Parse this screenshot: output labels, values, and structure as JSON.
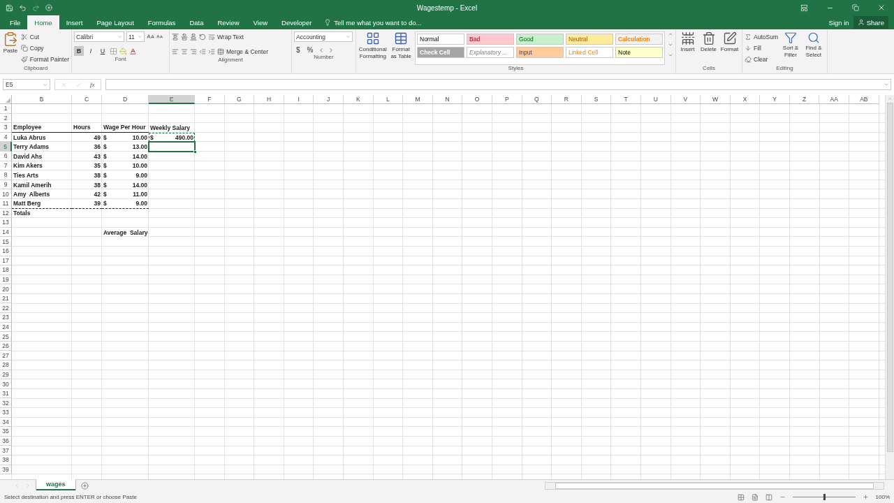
{
  "window": {
    "title": "Wagestemp - Excel",
    "sign_in": "Sign in",
    "share": "Share"
  },
  "menu_tabs": [
    {
      "label": "File",
      "selected": false
    },
    {
      "label": "Home",
      "selected": true
    },
    {
      "label": "Insert",
      "selected": false
    },
    {
      "label": "Page Layout",
      "selected": false
    },
    {
      "label": "Formulas",
      "selected": false
    },
    {
      "label": "Data",
      "selected": false
    },
    {
      "label": "Review",
      "selected": false
    },
    {
      "label": "View",
      "selected": false
    },
    {
      "label": "Developer",
      "selected": false
    }
  ],
  "tell_me": {
    "placeholder": "Tell me what you want to do..."
  },
  "ribbon": {
    "clipboard": {
      "label": "Clipboard",
      "paste": "Paste",
      "commands": [
        "Cut",
        "Copy",
        "Format Painter"
      ]
    },
    "font": {
      "label": "Font",
      "font_name": "Calibri",
      "font_size": "11",
      "toggles": [
        {
          "label": "B",
          "selected": true
        },
        {
          "label": "I",
          "selected": false
        },
        {
          "label": "U",
          "selected": false
        }
      ]
    },
    "alignment": {
      "label": "Alignment",
      "wrap": "Wrap Text",
      "merge": "Merge & Center"
    },
    "number": {
      "label": "Number",
      "format": "Accounting",
      "symbols": [
        "$",
        "%"
      ]
    },
    "styles": {
      "label": "Styles",
      "commands": [
        "Conditional Formatting",
        "Format as Table"
      ],
      "gallery": [
        {
          "label": "Normal",
          "kind": "normal",
          "color": "#ffffff"
        },
        {
          "label": "Bad",
          "kind": "bad",
          "color": "#ffc7ce"
        },
        {
          "label": "Good",
          "kind": "good",
          "color": "#c6efce"
        },
        {
          "label": "Neutral",
          "kind": "neutral",
          "color": "#ffeb9c"
        },
        {
          "label": "Calculation",
          "kind": "calculation",
          "color": "#f2f2f2"
        },
        {
          "label": "Check Cell",
          "kind": "check",
          "color": "#a5a5a5"
        },
        {
          "label": "Explanatory ...",
          "kind": "explanatory",
          "color": "#ffffff"
        },
        {
          "label": "Input",
          "kind": "input",
          "color": "#ffcc99"
        },
        {
          "label": "Linked Cell",
          "kind": "linked",
          "color": "#ffffff"
        },
        {
          "label": "Note",
          "kind": "note",
          "color": "#ffffcc"
        }
      ]
    },
    "cells": {
      "label": "Cells",
      "commands": [
        "Insert",
        "Delete",
        "Format"
      ]
    },
    "editing": {
      "label": "Editing",
      "small": [
        "AutoSum",
        "Fill",
        "Clear"
      ],
      "large": [
        "Sort & Filter",
        "Find & Select"
      ]
    }
  },
  "formula_bar": {
    "name_box": "E5",
    "function_label": "fx"
  },
  "sheet": {
    "columns": [
      {
        "label": "B",
        "selected": false
      },
      {
        "label": "C",
        "selected": false
      },
      {
        "label": "D",
        "selected": false
      },
      {
        "label": "E",
        "selected": true
      },
      {
        "label": "F",
        "selected": false
      },
      {
        "label": "G",
        "selected": false
      },
      {
        "label": "H",
        "selected": false
      },
      {
        "label": "I",
        "selected": false
      },
      {
        "label": "J",
        "selected": false
      },
      {
        "label": "K",
        "selected": false
      },
      {
        "label": "L",
        "selected": false
      },
      {
        "label": "M",
        "selected": false
      },
      {
        "label": "N",
        "selected": false
      },
      {
        "label": "O",
        "selected": false
      },
      {
        "label": "P",
        "selected": false
      },
      {
        "label": "Q",
        "selected": false
      },
      {
        "label": "R",
        "selected": false
      },
      {
        "label": "S",
        "selected": false
      },
      {
        "label": "T",
        "selected": false
      },
      {
        "label": "U",
        "selected": false
      },
      {
        "label": "V",
        "selected": false
      },
      {
        "label": "W",
        "selected": false
      },
      {
        "label": "X",
        "selected": false
      },
      {
        "label": "Y",
        "selected": false
      },
      {
        "label": "Z",
        "selected": false
      },
      {
        "label": "AA",
        "selected": false
      },
      {
        "label": "AB",
        "selected": false
      }
    ],
    "rows": [
      {
        "number": "1",
        "kind": "plain",
        "selected": false
      },
      {
        "number": "2",
        "kind": "plain",
        "selected": false
      },
      {
        "number": "3",
        "kind": "underlined",
        "selected": false,
        "cells": [
          {
            "kind": "text",
            "text": "Employee",
            "active": false,
            "copied": false
          },
          {
            "kind": "text",
            "text": "Hours",
            "active": false,
            "copied": false
          },
          {
            "kind": "text",
            "text": "Wage Per Hour",
            "active": false,
            "copied": false
          },
          {
            "kind": "text",
            "text": "Weekly Salary",
            "active": false,
            "copied": false
          }
        ]
      },
      {
        "number": "4",
        "kind": "plain",
        "selected": false,
        "cells": [
          {
            "kind": "text",
            "text": "Luka Abrus",
            "active": false,
            "copied": false
          },
          {
            "kind": "number",
            "text": "49",
            "active": false,
            "copied": false
          },
          {
            "kind": "accounting",
            "symbol": "$",
            "amount": "10.00",
            "active": false,
            "copied": false
          },
          {
            "kind": "accounting",
            "symbol": "$",
            "amount": "490.00",
            "active": false,
            "copied": true
          }
        ]
      },
      {
        "number": "5",
        "kind": "plain",
        "selected": true,
        "cells": [
          {
            "kind": "text",
            "text": "Terry Adams",
            "active": false,
            "copied": false
          },
          {
            "kind": "number",
            "text": "36",
            "active": false,
            "copied": false
          },
          {
            "kind": "accounting",
            "symbol": "$",
            "amount": "13.00",
            "active": false,
            "copied": false
          },
          {
            "kind": "empty",
            "active": true,
            "copied": false
          }
        ]
      },
      {
        "number": "6",
        "kind": "plain",
        "selected": false,
        "cells": [
          {
            "kind": "text",
            "text": "David Ahs",
            "active": false,
            "copied": false
          },
          {
            "kind": "number",
            "text": "43",
            "active": false,
            "copied": false
          },
          {
            "kind": "accounting",
            "symbol": "$",
            "amount": "14.00",
            "active": false,
            "copied": false
          },
          {
            "kind": "empty",
            "active": false,
            "copied": false
          }
        ]
      },
      {
        "number": "7",
        "kind": "plain",
        "selected": false,
        "cells": [
          {
            "kind": "text",
            "text": "Kim Akers",
            "active": false,
            "copied": false
          },
          {
            "kind": "number",
            "text": "35",
            "active": false,
            "copied": false
          },
          {
            "kind": "accounting",
            "symbol": "$",
            "amount": "10.00",
            "active": false,
            "copied": false
          },
          {
            "kind": "empty",
            "active": false,
            "copied": false
          }
        ]
      },
      {
        "number": "8",
        "kind": "plain",
        "selected": false,
        "cells": [
          {
            "kind": "text",
            "text": "Ties Arts",
            "active": false,
            "copied": false
          },
          {
            "kind": "number",
            "text": "38",
            "active": false,
            "copied": false
          },
          {
            "kind": "accounting",
            "symbol": "$",
            "amount": "9.00",
            "active": false,
            "copied": false
          },
          {
            "kind": "empty",
            "active": false,
            "copied": false
          }
        ]
      },
      {
        "number": "9",
        "kind": "plain",
        "selected": false,
        "cells": [
          {
            "kind": "text",
            "text": "Kamil Amerih",
            "active": false,
            "copied": false
          },
          {
            "kind": "number",
            "text": "38",
            "active": false,
            "copied": false
          },
          {
            "kind": "accounting",
            "symbol": "$",
            "amount": "14.00",
            "active": false,
            "copied": false
          },
          {
            "kind": "empty",
            "active": false,
            "copied": false
          }
        ]
      },
      {
        "number": "10",
        "kind": "plain",
        "selected": false,
        "cells": [
          {
            "kind": "text",
            "text": "Amy  Alberts",
            "active": false,
            "copied": false
          },
          {
            "kind": "number",
            "text": "42",
            "active": false,
            "copied": false
          },
          {
            "kind": "accounting",
            "symbol": "$",
            "amount": "11.00",
            "active": false,
            "copied": false
          },
          {
            "kind": "empty",
            "active": false,
            "copied": false
          }
        ]
      },
      {
        "number": "11",
        "kind": "dashed",
        "selected": false,
        "cells": [
          {
            "kind": "text",
            "text": "Matt Berg",
            "active": false,
            "copied": false
          },
          {
            "kind": "number",
            "text": "39",
            "active": false,
            "copied": false
          },
          {
            "kind": "accounting",
            "symbol": "$",
            "amount": "9.00",
            "active": false,
            "copied": false
          },
          {
            "kind": "empty",
            "active": false,
            "copied": false
          }
        ]
      },
      {
        "number": "12",
        "kind": "plain",
        "selected": false,
        "cells": [
          {
            "kind": "text",
            "text": "Totals",
            "active": false,
            "copied": false
          },
          {
            "kind": "empty",
            "active": false,
            "copied": false
          },
          {
            "kind": "empty",
            "active": false,
            "copied": false
          },
          {
            "kind": "empty",
            "active": false,
            "copied": false
          }
        ]
      },
      {
        "number": "13",
        "kind": "plain",
        "selected": false
      },
      {
        "number": "14",
        "kind": "plain",
        "selected": false,
        "cells": [
          {
            "kind": "empty",
            "active": false,
            "copied": false
          },
          {
            "kind": "empty",
            "active": false,
            "copied": false
          },
          {
            "kind": "text",
            "text": "Average  Salary",
            "active": false,
            "copied": false
          },
          {
            "kind": "empty",
            "active": false,
            "copied": false
          }
        ]
      },
      {
        "number": "15",
        "kind": "plain",
        "selected": false
      },
      {
        "number": "16",
        "kind": "plain",
        "selected": false
      },
      {
        "number": "17",
        "kind": "plain",
        "selected": false
      },
      {
        "number": "18",
        "kind": "plain",
        "selected": false
      },
      {
        "number": "19",
        "kind": "plain",
        "selected": false
      },
      {
        "number": "20",
        "kind": "plain",
        "selected": false
      },
      {
        "number": "21",
        "kind": "plain",
        "selected": false
      },
      {
        "number": "22",
        "kind": "plain",
        "selected": false
      },
      {
        "number": "23",
        "kind": "plain",
        "selected": false
      },
      {
        "number": "24",
        "kind": "plain",
        "selected": false
      },
      {
        "number": "25",
        "kind": "plain",
        "selected": false
      },
      {
        "number": "26",
        "kind": "plain",
        "selected": false
      },
      {
        "number": "27",
        "kind": "plain",
        "selected": false
      },
      {
        "number": "28",
        "kind": "plain",
        "selected": false
      },
      {
        "number": "29",
        "kind": "plain",
        "selected": false
      },
      {
        "number": "30",
        "kind": "plain",
        "selected": false
      },
      {
        "number": "31",
        "kind": "plain",
        "selected": false
      },
      {
        "number": "32",
        "kind": "plain",
        "selected": false
      },
      {
        "number": "33",
        "kind": "plain",
        "selected": false
      },
      {
        "number": "34",
        "kind": "plain",
        "selected": false
      },
      {
        "number": "35",
        "kind": "plain",
        "selected": false
      },
      {
        "number": "36",
        "kind": "plain",
        "selected": false
      },
      {
        "number": "37",
        "kind": "plain",
        "selected": false
      },
      {
        "number": "38",
        "kind": "plain",
        "selected": false
      },
      {
        "number": "39",
        "kind": "plain",
        "selected": false
      }
    ]
  },
  "sheet_tabs": [
    {
      "label": "wages",
      "selected": true
    }
  ],
  "status_bar": {
    "message": "Select destination and press ENTER or choose Paste",
    "zoom": "100%",
    "zoom_slider": {
      "level": 0.5
    }
  }
}
